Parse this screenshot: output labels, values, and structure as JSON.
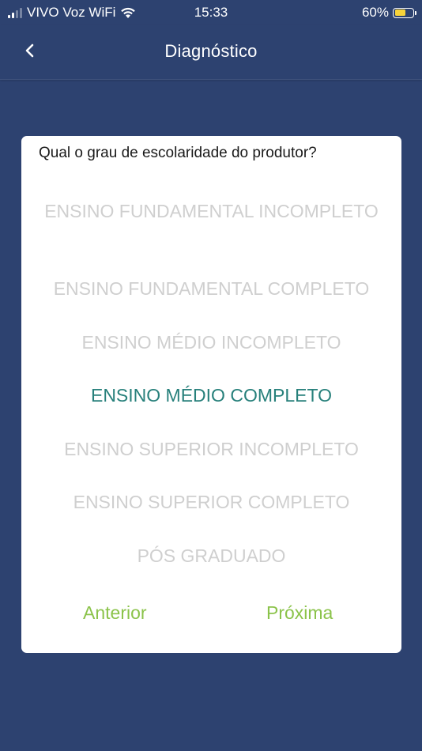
{
  "status_bar": {
    "carrier": "VIVO Voz WiFi",
    "time": "15:33",
    "battery_percent": "60%",
    "battery_level": 0.6,
    "battery_color": "#f7d33a"
  },
  "nav": {
    "title": "Diagnóstico",
    "back_icon": "chevron-left-icon"
  },
  "dialog": {
    "question": "Qual o grau de escolaridade do produtor?",
    "options": [
      "ENSINO FUNDAMENTAL INCOMPLETO",
      "ENSINO FUNDAMENTAL COMPLETO",
      "ENSINO MÉDIO INCOMPLETO",
      "ENSINO MÉDIO COMPLETO",
      "ENSINO SUPERIOR INCOMPLETO",
      "ENSINO SUPERIOR COMPLETO",
      "PÓS GRADUADO"
    ],
    "selected_option": "ENSINO MÉDIO COMPLETO",
    "prev_label": "Anterior",
    "next_label": "Próxima"
  },
  "colors": {
    "background": "#2d4270",
    "selected": "#27807b",
    "unselected": "#cfcfcf",
    "action": "#8bc34a"
  }
}
